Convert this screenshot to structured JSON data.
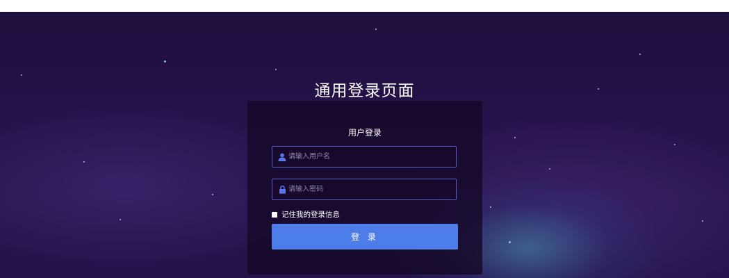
{
  "page": {
    "title": "通用登录页面"
  },
  "login_form": {
    "heading": "用户登录",
    "username": {
      "placeholder": "请输入用户名",
      "value": "",
      "icon": "user-icon"
    },
    "password": {
      "placeholder": "请输入密码",
      "value": "",
      "icon": "lock-icon"
    },
    "remember_label": "记住我的登录信息",
    "remember_checked": false,
    "submit_label": "登 录"
  },
  "colors": {
    "background": "#26124a",
    "card": "#160828",
    "field_border": "#5a63c9",
    "icon_accent": "#5b78ee",
    "button": "#4d7de8",
    "text": "#ffffff"
  }
}
